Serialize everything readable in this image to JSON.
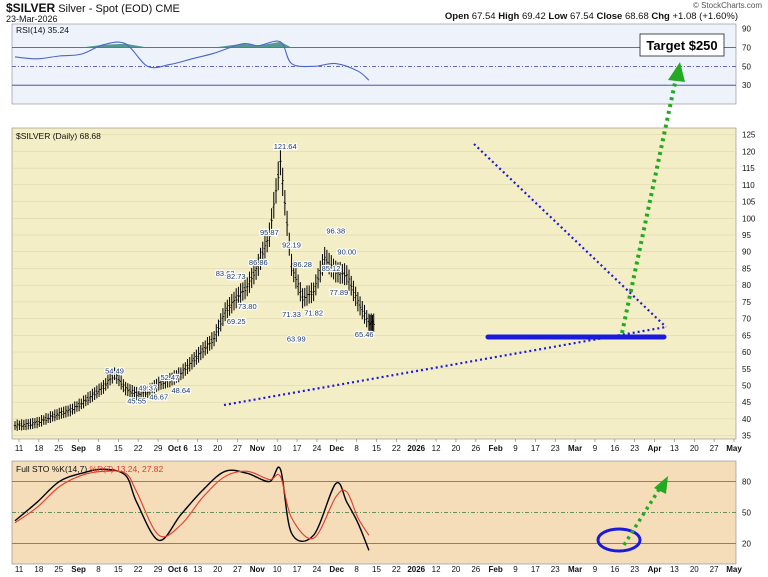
{
  "header": {
    "symbol": "$SILVER",
    "description": "Silver - Spot (EOD) CME",
    "date": "23-Mar-2026",
    "open_label": "Open",
    "open": "67.54",
    "high_label": "High",
    "high": "69.42",
    "low_label": "Low",
    "low": "67.54",
    "close_label": "Close",
    "close": "68.68",
    "chg_label": "Chg",
    "chg": "+1.08 (+1.60%)",
    "brand": "© StockCharts.com"
  },
  "colors": {
    "price_bg": "#f4eec6",
    "rsi_bg": "#eef2fa",
    "sto_bg": "#f4ddb8",
    "trendline": "#1a1adc",
    "target_arrow": "#22aa22",
    "rsi_line": "#4a66cc",
    "rsi_fill": "#3a8a80",
    "sto_k": "#000000",
    "sto_d": "#e23b2e"
  },
  "chart_data": [
    {
      "type": "line",
      "panel": "rsi",
      "label": "RSI(14) 35.24",
      "ylim": [
        10,
        95
      ],
      "yticks": [
        30,
        50,
        70,
        90
      ],
      "reference_lines": [
        30,
        50,
        70
      ],
      "x": [
        "Aug 11",
        "Aug 25",
        "Sep 8",
        "Sep 22",
        "Oct 6",
        "Oct 20",
        "Nov 3",
        "Nov 17",
        "Dec 1",
        "Dec 15",
        "Jan 2",
        "Jan 12",
        "Jan 26",
        "Feb 2",
        "Feb 16",
        "Mar 2",
        "Mar 16",
        "Mar 23"
      ],
      "values": [
        60,
        58,
        61,
        63,
        73,
        74,
        50,
        52,
        58,
        64,
        74,
        72,
        76,
        53,
        50,
        53,
        45,
        35.24
      ]
    },
    {
      "type": "candlestick",
      "panel": "price",
      "label": "$SILVER (Daily) 68.68",
      "ylim": [
        34,
        127
      ],
      "yticks": [
        35,
        40,
        45,
        50,
        55,
        60,
        65,
        70,
        75,
        80,
        85,
        90,
        95,
        100,
        105,
        110,
        115,
        120,
        125
      ],
      "x": [
        "Aug 11",
        "Aug 18",
        "Aug 25",
        "Sep 1",
        "Sep 8",
        "Sep 15",
        "Sep 22",
        "Sep 29",
        "Oct 6",
        "Oct 13",
        "Oct 20",
        "Oct 27",
        "Nov 3",
        "Nov 10",
        "Nov 17",
        "Nov 24",
        "Dec 1",
        "Dec 8",
        "Dec 15",
        "Dec 22",
        "Dec 29",
        "Jan 5",
        "Jan 12",
        "Jan 19",
        "Jan 26",
        "Feb 2",
        "Feb 9",
        "Feb 16",
        "Feb 23",
        "Mar 2",
        "Mar 9",
        "Mar 16",
        "Mar 23"
      ],
      "values": [
        38.0,
        38.2,
        38.8,
        40.2,
        41.5,
        42.5,
        44.5,
        47.0,
        49.5,
        53.5,
        49.0,
        47.5,
        48.0,
        50.5,
        51.5,
        53.5,
        57.0,
        60.5,
        64.0,
        72.0,
        76.0,
        79.5,
        86.0,
        95.0,
        117.0,
        86.0,
        76.0,
        78.0,
        88.0,
        84.0,
        83.0,
        75.0,
        68.68
      ],
      "annotations": [
        {
          "label": "54.49",
          "x": "Oct 13",
          "value": 54.49
        },
        {
          "label": "45.55",
          "x": "Oct 27",
          "value": 45.55
        },
        {
          "label": "49.37",
          "x": "Nov 3",
          "value": 49.37
        },
        {
          "label": "46.67",
          "x": "Nov 10",
          "value": 46.67
        },
        {
          "label": "52.47",
          "x": "Nov 17",
          "value": 52.47
        },
        {
          "label": "48.64",
          "x": "Nov 24",
          "value": 48.64
        },
        {
          "label": "83.62",
          "x": "Dec 22",
          "value": 83.62
        },
        {
          "label": "69.25",
          "x": "Dec 29",
          "value": 69.25
        },
        {
          "label": "82.73",
          "x": "Dec 29",
          "value": 82.73
        },
        {
          "label": "73.80",
          "x": "Jan 5",
          "value": 73.8
        },
        {
          "label": "86.86",
          "x": "Jan 12",
          "value": 86.86
        },
        {
          "label": "95.87",
          "x": "Jan 19",
          "value": 95.87
        },
        {
          "label": "121.64",
          "x": "Jan 29",
          "value": 121.64
        },
        {
          "label": "92.19",
          "x": "Feb 2",
          "value": 92.19
        },
        {
          "label": "71.33",
          "x": "Feb 2",
          "value": 71.33
        },
        {
          "label": "63.99",
          "x": "Feb 5",
          "value": 63.99
        },
        {
          "label": "86.28",
          "x": "Feb 9",
          "value": 86.28
        },
        {
          "label": "71.82",
          "x": "Feb 16",
          "value": 71.82
        },
        {
          "label": "85.12",
          "x": "Feb 27",
          "value": 85.12
        },
        {
          "label": "96.38",
          "x": "Mar 2",
          "value": 96.38
        },
        {
          "label": "77.89",
          "x": "Mar 4",
          "value": 77.89
        },
        {
          "label": "90.00",
          "x": "Mar 9",
          "value": 90.0
        },
        {
          "label": "65.46",
          "x": "Mar 20",
          "value": 65.46
        }
      ],
      "target_label": "Target $250"
    },
    {
      "type": "line",
      "panel": "stochastic",
      "label": "Full STO %K(14,7) %D(7) 13.24, 27.82",
      "label_k": "Full STO %K(14,7)",
      "label_d": "%D(7) 13.24, 27.82",
      "ylim": [
        0,
        100
      ],
      "yticks": [
        20,
        50,
        80
      ],
      "reference_lines": [
        20,
        50,
        80
      ],
      "x": [
        "Aug 11",
        "Aug 25",
        "Sep 8",
        "Sep 22",
        "Oct 6",
        "Oct 20",
        "Oct 27",
        "Nov 10",
        "Nov 24",
        "Dec 8",
        "Dec 22",
        "Jan 5",
        "Jan 19",
        "Jan 26",
        "Feb 2",
        "Feb 16",
        "Mar 2",
        "Mar 9",
        "Mar 16",
        "Mar 23"
      ],
      "series": [
        {
          "name": "%K",
          "values": [
            42,
            60,
            80,
            88,
            92,
            86,
            60,
            23,
            48,
            72,
            90,
            88,
            80,
            92,
            30,
            28,
            78,
            60,
            40,
            13.24
          ]
        },
        {
          "name": "%D",
          "values": [
            40,
            55,
            75,
            86,
            90,
            88,
            70,
            28,
            38,
            65,
            85,
            90,
            82,
            85,
            45,
            25,
            65,
            70,
            45,
            27.82
          ]
        }
      ]
    }
  ],
  "x_axis": {
    "ticks": [
      "11",
      "18",
      "25",
      "Sep",
      "8",
      "15",
      "22",
      "29",
      "Oct 6",
      "13",
      "20",
      "27",
      "Nov",
      "10",
      "17",
      "24",
      "Dec",
      "8",
      "15",
      "22",
      "2026",
      "12",
      "20",
      "26",
      "Feb",
      "9",
      "17",
      "23",
      "Mar",
      "9",
      "16",
      "23",
      "Apr",
      "13",
      "20",
      "27",
      "May"
    ]
  }
}
